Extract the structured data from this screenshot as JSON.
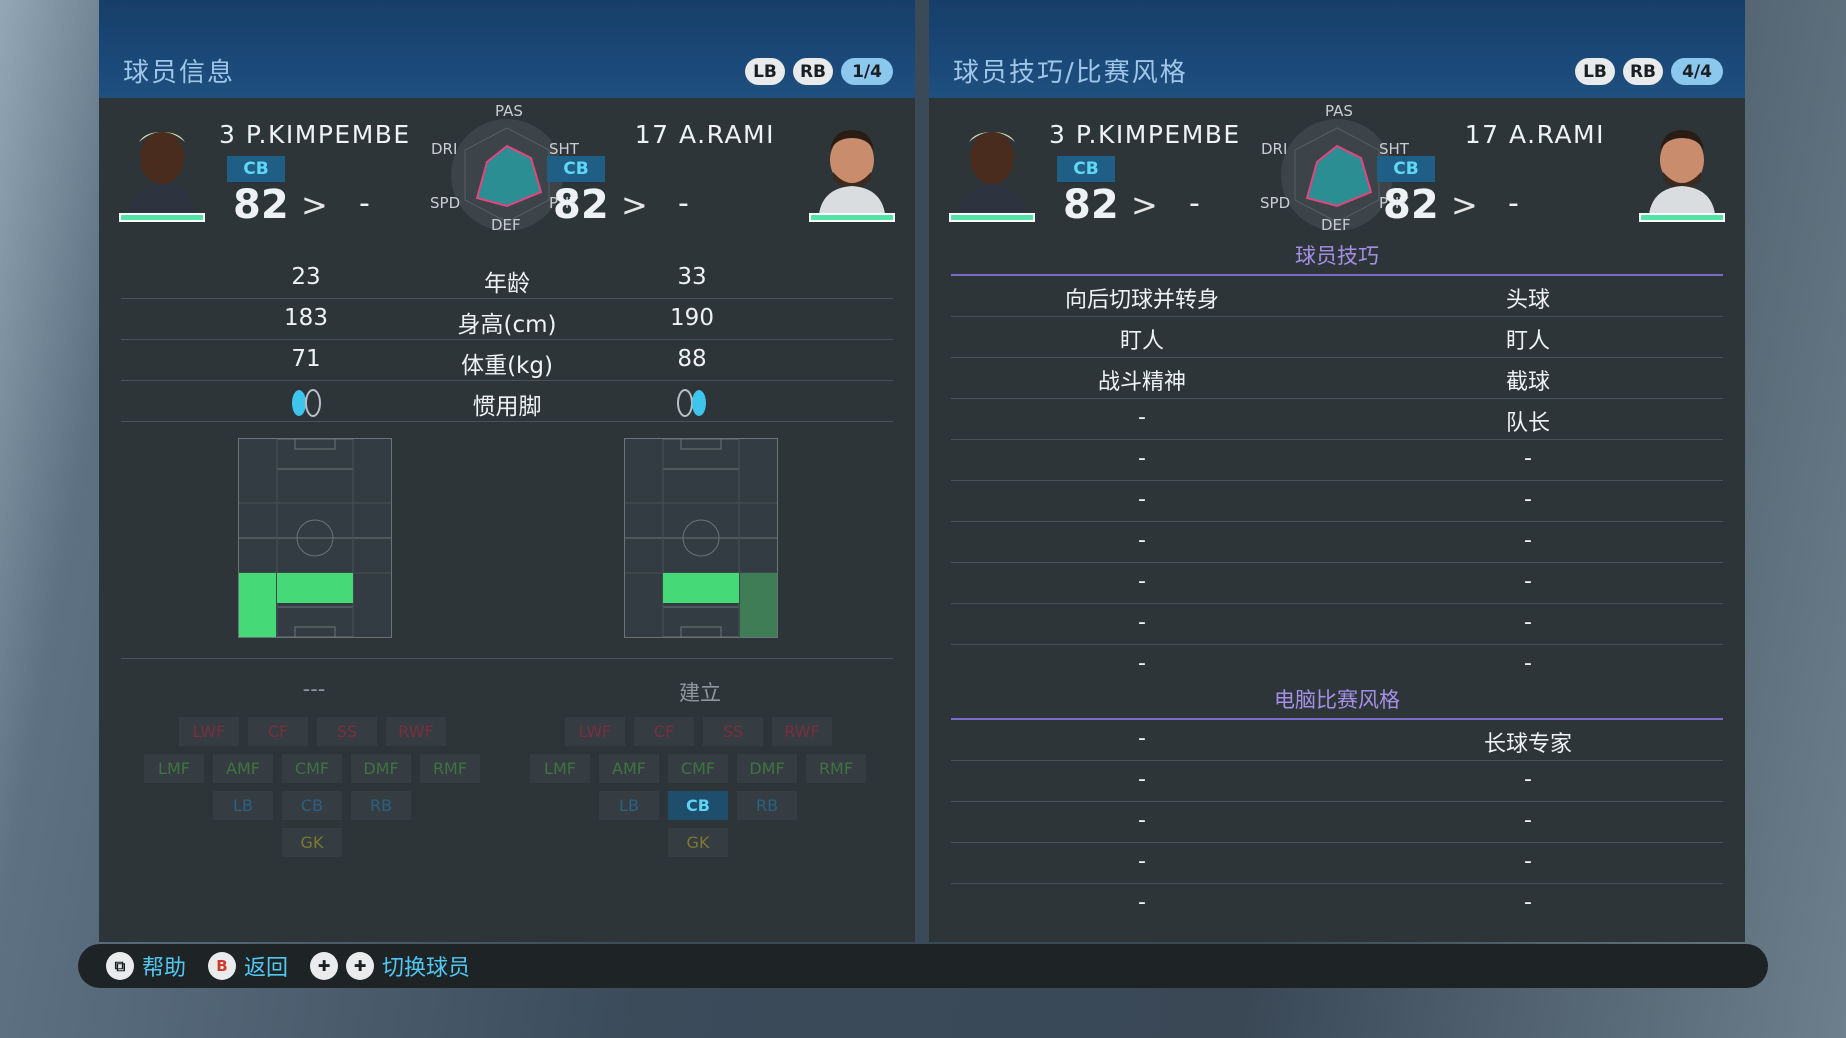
{
  "left_panel": {
    "title": "球员信息",
    "chips": [
      "LB",
      "RB"
    ],
    "page": "1/4",
    "player1": {
      "name": "3 P.KIMPEMBE",
      "pos": "CB",
      "rating": "82",
      "arrow": ">",
      "dash": "-"
    },
    "player2": {
      "name": "17 A.RAMI",
      "pos": "CB",
      "rating": "82",
      "arrow": ">",
      "dash": "-"
    },
    "radar_labels": {
      "pas": "PAS",
      "sht": "SHT",
      "phy": "PHY",
      "def": "DEF",
      "spd": "SPD",
      "dri": "DRI"
    },
    "stats": [
      {
        "left": "23",
        "label": "年龄",
        "right": "33"
      },
      {
        "left": "183",
        "label": "身高(cm)",
        "right": "190"
      },
      {
        "left": "71",
        "label": "体重(kg)",
        "right": "88"
      },
      {
        "left": "",
        "label": "惯用脚",
        "right": ""
      }
    ],
    "player1_style": "---",
    "player2_style": "建立",
    "positions": {
      "fw": [
        "LWF",
        "CF",
        "SS",
        "RWF"
      ],
      "mf": [
        "LMF",
        "AMF",
        "CMF",
        "DMF",
        "RMF"
      ],
      "df": [
        "LB",
        "CB",
        "RB"
      ],
      "gk": [
        "GK"
      ]
    }
  },
  "right_panel": {
    "title": "球员技巧/比赛风格",
    "chips": [
      "LB",
      "RB"
    ],
    "page": "4/4",
    "player1": {
      "name": "3 P.KIMPEMBE",
      "pos": "CB",
      "rating": "82",
      "arrow": ">",
      "dash": "-"
    },
    "player2": {
      "name": "17 A.RAMI",
      "pos": "CB",
      "rating": "82",
      "arrow": ">",
      "dash": "-"
    },
    "radar_labels": {
      "pas": "PAS",
      "sht": "SHT",
      "phy": "PHY",
      "def": "DEF",
      "spd": "SPD",
      "dri": "DRI"
    },
    "skills_title": "球员技巧",
    "skills": [
      {
        "left": "向后切球并转身",
        "right": "头球"
      },
      {
        "left": "盯人",
        "right": "盯人"
      },
      {
        "left": "战斗精神",
        "right": "截球"
      },
      {
        "left": "-",
        "right": "队长"
      },
      {
        "left": "-",
        "right": "-"
      },
      {
        "left": "-",
        "right": "-"
      },
      {
        "left": "-",
        "right": "-"
      },
      {
        "left": "-",
        "right": "-"
      },
      {
        "left": "-",
        "right": "-"
      },
      {
        "left": "-",
        "right": "-"
      }
    ],
    "ai_title": "电脑比赛风格",
    "ai_styles": [
      {
        "left": "-",
        "right": "长球专家"
      },
      {
        "left": "-",
        "right": "-"
      },
      {
        "left": "-",
        "right": "-"
      },
      {
        "left": "-",
        "right": "-"
      },
      {
        "left": "-",
        "right": "-"
      }
    ]
  },
  "bottom_bar": {
    "help": "帮助",
    "back": "返回",
    "switch": "切换球员",
    "b_button": "B"
  },
  "colors": {
    "accent": "#51c8f2",
    "rating_bar": "#52e3a6",
    "position_active": "#46d977"
  }
}
